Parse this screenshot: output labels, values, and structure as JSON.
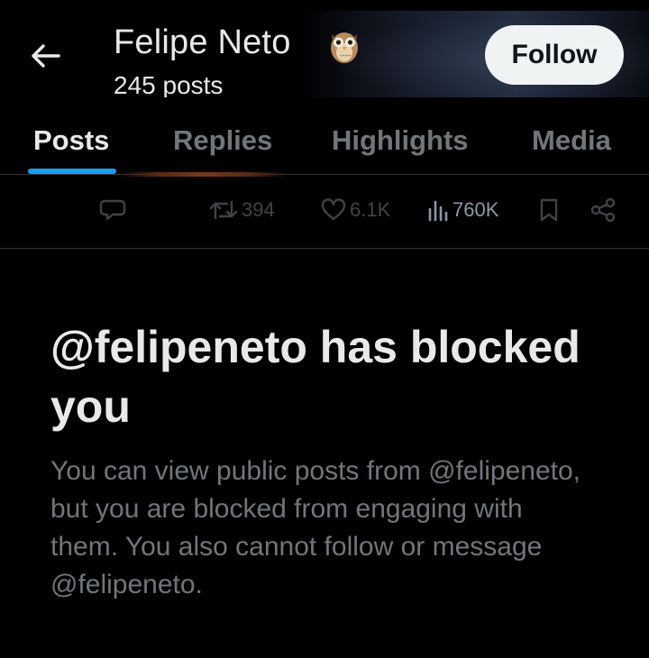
{
  "header": {
    "title": "Felipe Neto",
    "post_count": "245 posts",
    "follow_label": "Follow"
  },
  "tabs": [
    {
      "label": "Posts",
      "active": true
    },
    {
      "label": "Replies",
      "active": false
    },
    {
      "label": "Highlights",
      "active": false
    },
    {
      "label": "Media",
      "active": false
    }
  ],
  "post_actions": {
    "reply_icon": "speech-bubble",
    "repost_count": "394",
    "like_count": "6.1K",
    "view_count": "760K",
    "bookmark_icon": "bookmark",
    "share_icon": "share"
  },
  "blocked": {
    "title": "@felipeneto has blocked you",
    "description": "You can view public posts from @felipeneto, but you are blocked from engaging with them. You also cannot follow or message @felipeneto."
  },
  "colors": {
    "background": "#000000",
    "primary_text": "#e7e9ea",
    "secondary_text": "#71767b",
    "accent": "#1d9bf0",
    "follow_bg": "#eff3f4"
  }
}
